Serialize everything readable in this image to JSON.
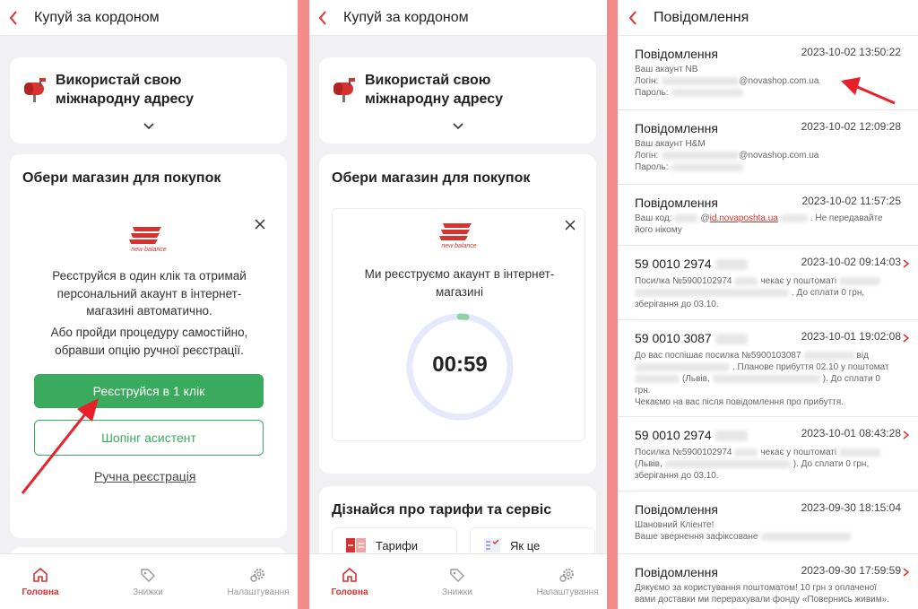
{
  "colors": {
    "accent": "#d8322f",
    "green": "#3aaa5f",
    "frame": "#f58a8a",
    "timer_ring": "#e6e8fb",
    "timer_progress": "#8fd3a5"
  },
  "panel1": {
    "header": {
      "title": "Купуй за кордоном",
      "back_icon": "chevron-left-icon"
    },
    "address_card": {
      "title_line1": "Використай свою",
      "title_line2": "міжнародну адресу",
      "icon": "mailbox-icon"
    },
    "shop_section": {
      "title": "Обери магазин для покупок"
    },
    "shop_card": {
      "brand": "new balance",
      "text1": [
        "Реєструйся в один клік та отримай",
        "персональний акаунт в інтернет-",
        "магазині автоматично."
      ],
      "text2": [
        "Або пройди процедуру самостійно,",
        "обравши опцію ручної реєстрації."
      ],
      "primary_button": "Реєструйся в 1 клік",
      "secondary_button": "Шопінг асистент",
      "manual_link": "Ручна реєстрація"
    }
  },
  "panel2": {
    "header": {
      "title": "Купуй за кордоном"
    },
    "address_card": {
      "title_line1": "Використай свою",
      "title_line2": "міжнародну адресу"
    },
    "shop_section": {
      "title": "Обери магазин для покупок"
    },
    "shop_card": {
      "brand": "new balance",
      "text": [
        "Ми реєструємо акаунт в інтернет-",
        "магазині"
      ],
      "timer": "00:59",
      "timer_progress": 0.02
    },
    "tariffs": {
      "title": "Дізнайся про тарифи та сервіс",
      "tile1": "Тарифи",
      "tile2": "Як це"
    }
  },
  "tabbar": {
    "home": "Головна",
    "discounts": "Знижки",
    "settings": "Налаштування"
  },
  "panel3": {
    "header": {
      "title": "Повідомлення"
    },
    "messages": [
      {
        "title": "Повідомлення",
        "time": "2023-10-02 13:50:22",
        "l1": "Ваш акаунт NB",
        "l2a": "Логін:",
        "l2b": "@novashop.com.ua",
        "l3": "Пароль:"
      },
      {
        "title": "Повідомлення",
        "time": "2023-10-02 12:09:28",
        "l1": "Ваш акаунт H&M",
        "l2a": "Логін:",
        "l2b": "@novashop.com.ua",
        "l3": "Пароль:"
      },
      {
        "title": "Повідомлення",
        "time": "2023-10-02 11:57:25",
        "l1a": "Ваш код:",
        "l1b": "@",
        "l1c": "id.novaposhta.ua",
        "l1d": ". Не передавайте",
        "l2": "його нікому"
      },
      {
        "title": "59 0010 2974",
        "time": "2023-10-02 09:14:03",
        "l1a": "Посилка №5900102974",
        "l1b": "чекає у поштоматі",
        "l2a": ". До сплати 0 грн,",
        "l3": "зберігання до 03.10."
      },
      {
        "title": "59 0010 3087",
        "time": "2023-10-01 19:02:08",
        "l1a": "До вас поспішає посилка №5900103087",
        "l1b": "від",
        "l2a": ". Планове прибуття 02.10 у поштомат",
        "l3a": "(Львів,",
        "l3b": "). До сплати 0",
        "l4": "грн.",
        "l5": "Чекаємо на вас після повідомлення про прибуття."
      },
      {
        "title": "59 0010 2974",
        "time": "2023-10-01 08:43:28",
        "l1a": "Посилка №5900102974",
        "l1b": "чекає у поштоматі",
        "l2a": "(Львів,",
        "l2b": "). До сплати 0 грн,",
        "l3": "зберігання до 03.10."
      },
      {
        "title": "Повідомлення",
        "time": "2023-09-30 18:15:04",
        "l1": "Шановний Кліенте!",
        "l2": "Ваше звернення зафіксоване"
      },
      {
        "title": "Повідомлення",
        "time": "2023-09-30 17:59:59",
        "l1": "Дякуємо за користування поштоматом! 10 грн з оплаченої",
        "l2": "вами доставки ми перерахували фонду «Повернись живим»."
      }
    ]
  }
}
